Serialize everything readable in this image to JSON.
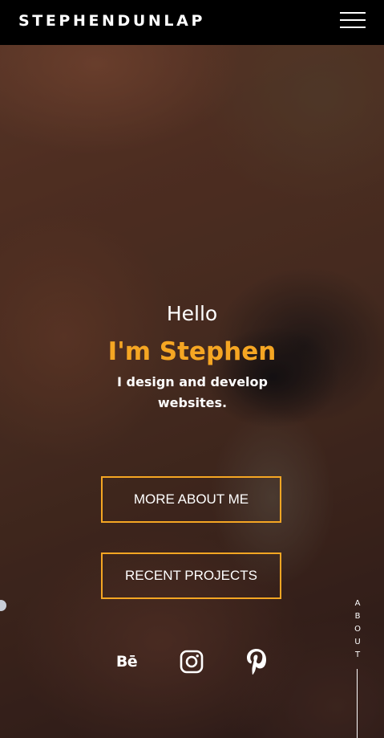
{
  "header": {
    "logo_text": "STEPHENDUNLAP",
    "menu_icon": "hamburger-menu-icon"
  },
  "hero": {
    "greeting": "Hello",
    "name": "I'm Stephen",
    "tagline": "I design and develop websites."
  },
  "buttons": {
    "about_label": "MORE ABOUT ME",
    "projects_label": "RECENT PROJECTS"
  },
  "social": {
    "behance_text": "Bē",
    "icons": [
      "behance-icon",
      "instagram-icon",
      "pinterest-icon"
    ]
  },
  "side_nav": {
    "letters": [
      "A",
      "B",
      "O",
      "U",
      "T"
    ]
  },
  "colors": {
    "accent": "#f5a623",
    "header_bg": "#000000",
    "text": "#ffffff"
  }
}
